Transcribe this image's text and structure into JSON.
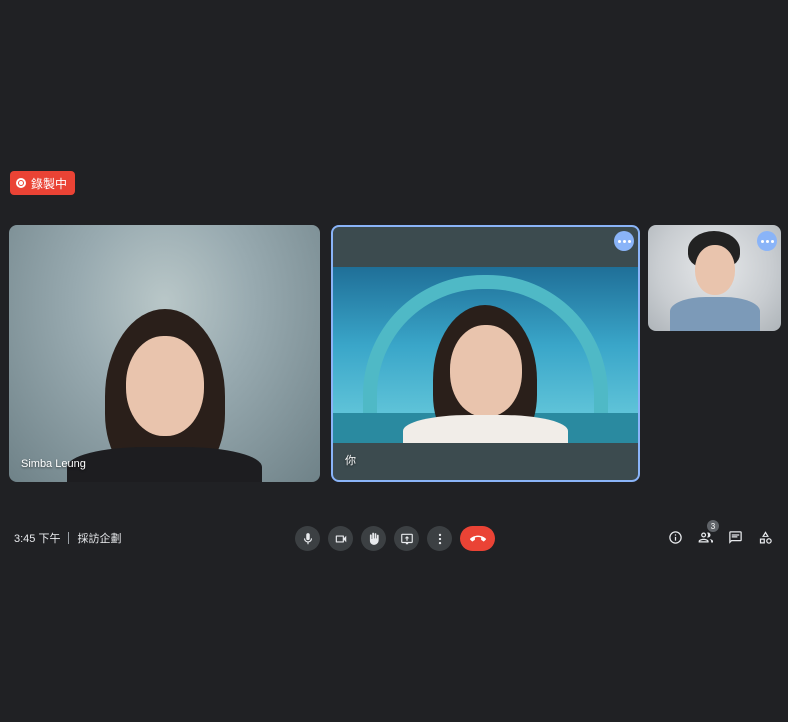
{
  "recording": {
    "label": "錄製中",
    "color": "#ea4335"
  },
  "participants": [
    {
      "name": "Simba Leung"
    },
    {
      "name": "你"
    },
    {
      "name": ""
    }
  ],
  "meeting": {
    "time": "3:45 下午",
    "title": "採訪企劃"
  },
  "controls": {
    "items": [
      {
        "name": "mic-button",
        "icon": "microphone-icon"
      },
      {
        "name": "camera-button",
        "icon": "camera-icon"
      },
      {
        "name": "raise-hand-button",
        "icon": "hand-icon"
      },
      {
        "name": "present-button",
        "icon": "present-screen-icon"
      },
      {
        "name": "more-options-button",
        "icon": "more-vert-icon"
      },
      {
        "name": "leave-call-button",
        "icon": "end-call-icon"
      }
    ]
  },
  "tools": {
    "people_count": "3"
  },
  "colors": {
    "background": "#202124",
    "accent": "#8ab4f8",
    "danger": "#ea4335"
  }
}
